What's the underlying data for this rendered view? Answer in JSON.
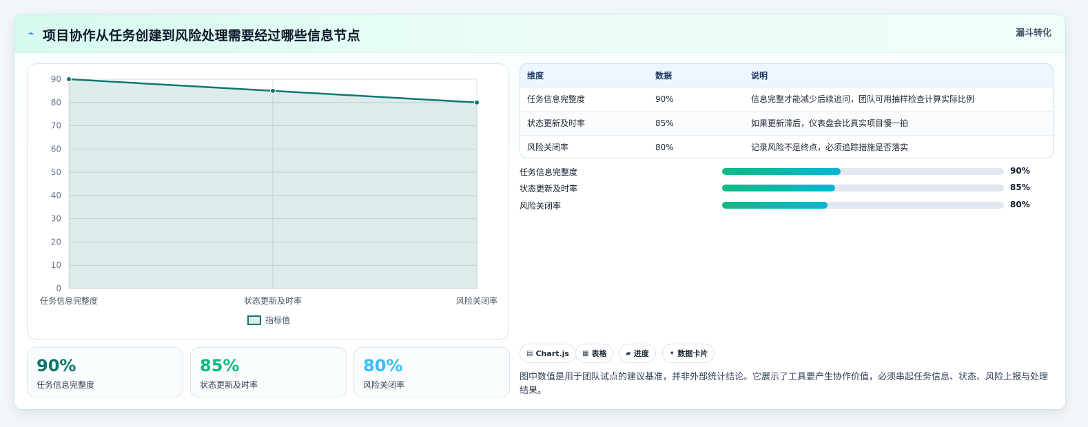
{
  "header": {
    "title": "项目协作从任务创建到风险处理需要经过哪些信息节点",
    "badge": "漏斗转化",
    "title_icon": "bolt-icon"
  },
  "chart_data": {
    "type": "line",
    "categories": [
      "任务信息完整度",
      "状态更新及时率",
      "风险关闭率"
    ],
    "series": [
      {
        "name": "指标值",
        "values": [
          90,
          85,
          80
        ],
        "color": "#0f766e",
        "fill": "rgba(15,118,110,0.14)"
      }
    ],
    "ylim": [
      0,
      90
    ],
    "yticks": [
      0,
      10,
      20,
      30,
      40,
      50,
      60,
      70,
      80,
      90
    ],
    "grid": true,
    "legend_position": "bottom"
  },
  "kpis": [
    {
      "value": "90%",
      "label": "任务信息完整度",
      "color": "#0f766e"
    },
    {
      "value": "85%",
      "label": "状态更新及时率",
      "color": "#10b981"
    },
    {
      "value": "80%",
      "label": "风险关闭率",
      "color": "#38bdf8"
    }
  ],
  "table": {
    "headers": [
      "维度",
      "数据",
      "说明"
    ],
    "rows": [
      [
        "任务信息完整度",
        "90%",
        "信息完整才能减少后续追问，团队可用抽样检查计算实际比例"
      ],
      [
        "状态更新及时率",
        "85%",
        "如果更新滞后，仪表盘会比真实项目慢一拍"
      ],
      [
        "风险关闭率",
        "80%",
        "记录风险不是终点，必须追踪措施是否落实"
      ]
    ]
  },
  "progress": [
    {
      "label": "任务信息完整度",
      "value": "90%",
      "fraction": 0.42
    },
    {
      "label": "状态更新及时率",
      "value": "85%",
      "fraction": 0.4
    },
    {
      "label": "风险关闭率",
      "value": "80%",
      "fraction": 0.375
    }
  ],
  "pills": [
    {
      "icon": "▤",
      "label": "Chart.js"
    },
    {
      "icon": "▦",
      "label": "表格"
    },
    {
      "icon": "▰",
      "label": "进度"
    },
    {
      "icon": "✦",
      "label": "数据卡片"
    }
  ],
  "footnote": "图中数值是用于团队试点的建议基准，并非外部统计结论。它展示了工具要产生协作价值，必须串起任务信息、状态、风险上报与处理结果。"
}
